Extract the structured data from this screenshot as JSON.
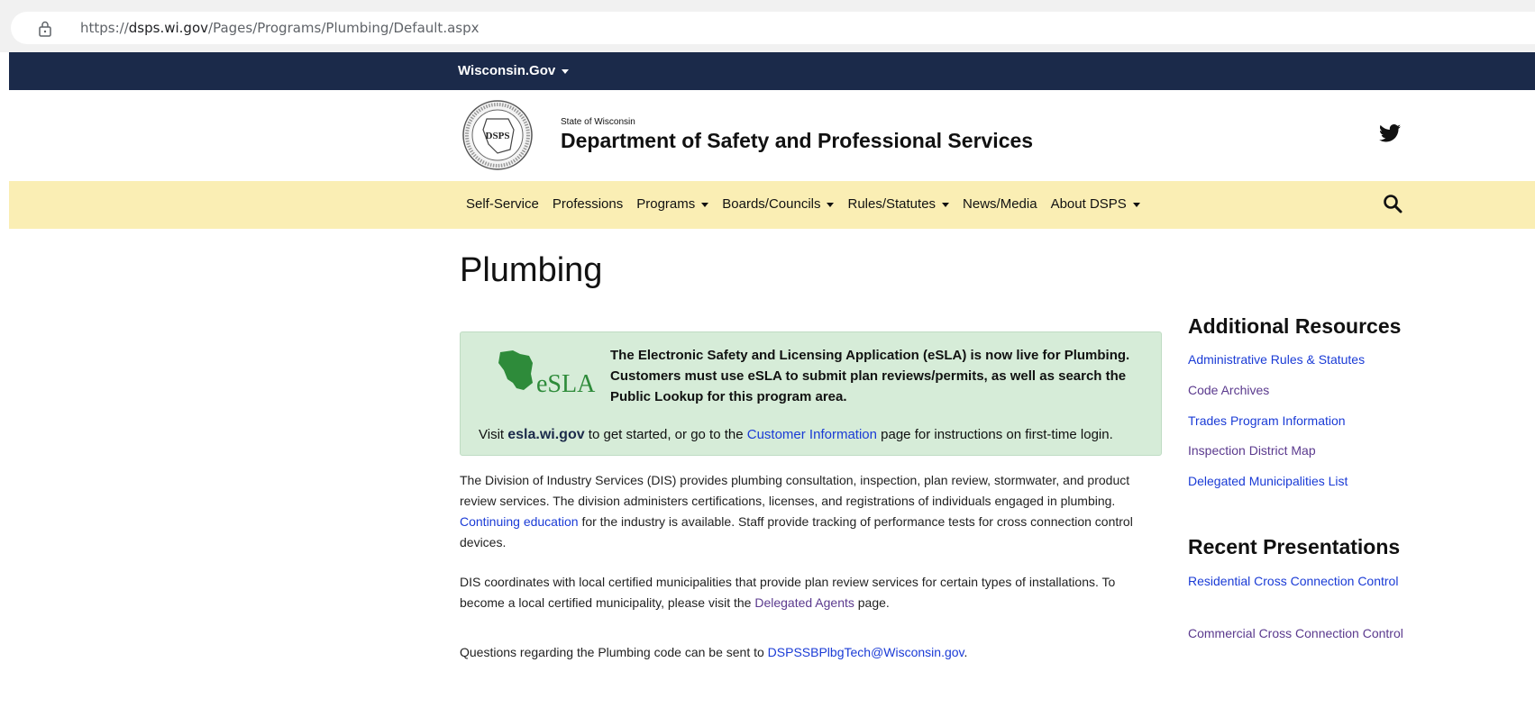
{
  "browser": {
    "url_prefix": "https://",
    "url_domain": "dsps.wi.gov",
    "url_path": "/Pages/Programs/Plumbing/Default.aspx"
  },
  "govbar": {
    "label": "Wisconsin.Gov"
  },
  "header": {
    "state": "State of Wisconsin",
    "department": "Department of Safety and Professional Services",
    "seal_text": "DSPS"
  },
  "nav": {
    "items": [
      {
        "label": "Self-Service",
        "dropdown": false
      },
      {
        "label": "Professions",
        "dropdown": false
      },
      {
        "label": "Programs",
        "dropdown": true
      },
      {
        "label": "Boards/Councils",
        "dropdown": true
      },
      {
        "label": "Rules/Statutes",
        "dropdown": true
      },
      {
        "label": "News/Media",
        "dropdown": false
      },
      {
        "label": "About DSPS",
        "dropdown": true
      }
    ]
  },
  "page": {
    "title": "Plumbing"
  },
  "esla": {
    "logo_text": "eSLA",
    "announcement": "The Electronic Safety and Licensing Application (eSLA) is now live for Plumbing. Customers must use eSLA to submit plan reviews/permits, as well as search the Public Lookup for this program area.",
    "visit_prefix": "Visit",
    "site": "esla.wi.gov",
    "visit_middle": "to get started, or go to the",
    "customer_link": "Customer Information",
    "visit_suffix": "page for instructions on first-time login."
  },
  "body": {
    "p1_a": "The Division of Industry Services (DIS) provides plumbing consultation, inspection, plan review, stormwater, and product review services. The division administers certifications, licenses, and registrations of individuals engaged in plumbing.",
    "p1_link": "Continuing education",
    "p1_b": "for the industry is available. Staff provide tracking of performance tests for cross connection control devices.",
    "p2_a": "DIS coordinates with local certified municipalities that provide plan review services for certain types of installations. To become a local certified municipality, please visit the",
    "p2_link": "Delegated Agents",
    "p2_b": "page.",
    "p3_a": "Questions regarding the Plumbing code can be sent to",
    "p3_link": "DSPSSBPlbgTech@Wisconsin.gov",
    "p3_b": "."
  },
  "sidebar": {
    "additional_title": "Additional Resources",
    "additional_links": [
      "Administrative Rules & Statutes",
      "Code Archives",
      "Trades Program Information",
      "Inspection District Map",
      "Delegated Municipalities List"
    ],
    "presentations_title": "Recent Presentations",
    "presentation_links": [
      "Residential Cross Connection Control",
      "Commercial Cross Connection Control"
    ]
  },
  "colors": {
    "gov_bar": "#1b2a4a",
    "nav_bg": "#faeeb4",
    "esla_bg": "#d6ecd8",
    "link": "#1a3bd6",
    "visited_link": "#5b3a8e"
  }
}
